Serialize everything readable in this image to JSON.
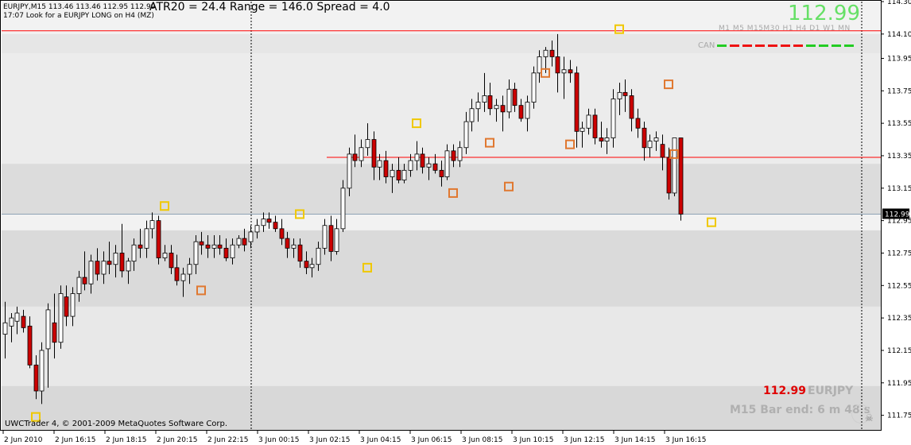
{
  "chart": {
    "symbol_info": "EURJPY,M15  113.46 113.46 112.95 112.99",
    "comment": "17:07 Look for a EURJPY LONG on H4 (MZ)",
    "stats": "ATR20 = 24.4 Range = 146.0 Spread = 4.0",
    "big_price": "112.99",
    "timeframes": "M1 M5 M15M30  H1  H4  D1  W1 MN",
    "can_label": "CAN",
    "footer_price": "112.99",
    "footer_symbol": "EURJPY",
    "bar_end": "M15 Bar end: 6 m 48 s",
    "copyright": "UWCTrader 4, © 2001-2009 MetaQuotes Software Corp.",
    "current_price_label": "112.99"
  },
  "colors": {
    "bull": "#ffffff",
    "bear": "#cc0000",
    "grid": "#000000",
    "resistance": "#ff0000",
    "price_line": "#8fa3b5",
    "marker_high": "#f0c800",
    "marker_low": "#e07830",
    "big_price": "#66e066"
  },
  "chart_data": {
    "type": "candlestick",
    "y_range": [
      111.66,
      114.3
    ],
    "y_ticks": [
      "114.30",
      "114.10",
      "113.95",
      "113.75",
      "113.55",
      "113.35",
      "113.15",
      "112.95",
      "112.75",
      "112.55",
      "112.35",
      "112.15",
      "111.95",
      "111.75"
    ],
    "x_labels": [
      "2 Jun 2010",
      "2 Jun 16:15",
      "2 Jun 18:15",
      "2 Jun 20:15",
      "2 Jun 22:15",
      "3 Jun 00:15",
      "3 Jun 02:15",
      "3 Jun 04:15",
      "3 Jun 06:15",
      "3 Jun 08:15",
      "3 Jun 10:15",
      "3 Jun 12:15",
      "3 Jun 14:15",
      "3 Jun 16:15"
    ],
    "horizontal_lines": [
      114.12,
      113.34
    ],
    "current_price": 112.99,
    "zones": [
      {
        "from": 113.98,
        "to": 114.1,
        "shade": "#e6e6e6"
      },
      {
        "from": 113.3,
        "to": 113.98,
        "shade": "#ececec"
      },
      {
        "from": 112.99,
        "to": 113.3,
        "shade": "#dcdcdc"
      },
      {
        "from": 112.42,
        "to": 112.89,
        "shade": "#dadada"
      },
      {
        "from": 111.93,
        "to": 112.42,
        "shade": "#e8e8e8"
      },
      {
        "from": 111.66,
        "to": 111.93,
        "shade": "#d8d8d8"
      }
    ],
    "candles": [
      {
        "o": 112.25,
        "h": 112.45,
        "l": 112.1,
        "c": 112.32
      },
      {
        "o": 112.3,
        "h": 112.38,
        "l": 112.2,
        "c": 112.35
      },
      {
        "o": 112.33,
        "h": 112.42,
        "l": 112.25,
        "c": 112.38
      },
      {
        "o": 112.36,
        "h": 112.4,
        "l": 112.26,
        "c": 112.29
      },
      {
        "o": 112.3,
        "h": 112.36,
        "l": 112.04,
        "c": 112.06
      },
      {
        "o": 112.06,
        "h": 112.12,
        "l": 111.85,
        "c": 111.9
      },
      {
        "o": 111.9,
        "h": 112.2,
        "l": 111.82,
        "c": 112.15
      },
      {
        "o": 112.16,
        "h": 112.44,
        "l": 111.92,
        "c": 112.4
      },
      {
        "o": 112.32,
        "h": 112.5,
        "l": 112.1,
        "c": 112.2
      },
      {
        "o": 112.2,
        "h": 112.55,
        "l": 112.16,
        "c": 112.5
      },
      {
        "o": 112.48,
        "h": 112.55,
        "l": 112.3,
        "c": 112.36
      },
      {
        "o": 112.36,
        "h": 112.54,
        "l": 112.3,
        "c": 112.5
      },
      {
        "o": 112.5,
        "h": 112.64,
        "l": 112.45,
        "c": 112.6
      },
      {
        "o": 112.6,
        "h": 112.76,
        "l": 112.52,
        "c": 112.56
      },
      {
        "o": 112.56,
        "h": 112.74,
        "l": 112.5,
        "c": 112.7
      },
      {
        "o": 112.7,
        "h": 112.78,
        "l": 112.58,
        "c": 112.62
      },
      {
        "o": 112.62,
        "h": 112.76,
        "l": 112.56,
        "c": 112.7
      },
      {
        "o": 112.7,
        "h": 112.82,
        "l": 112.62,
        "c": 112.68
      },
      {
        "o": 112.68,
        "h": 112.8,
        "l": 112.6,
        "c": 112.75
      },
      {
        "o": 112.75,
        "h": 112.93,
        "l": 112.6,
        "c": 112.64
      },
      {
        "o": 112.64,
        "h": 112.72,
        "l": 112.56,
        "c": 112.7
      },
      {
        "o": 112.7,
        "h": 112.84,
        "l": 112.64,
        "c": 112.8
      },
      {
        "o": 112.8,
        "h": 112.9,
        "l": 112.72,
        "c": 112.78
      },
      {
        "o": 112.78,
        "h": 112.95,
        "l": 112.72,
        "c": 112.9
      },
      {
        "o": 112.9,
        "h": 113.0,
        "l": 112.84,
        "c": 112.95
      },
      {
        "o": 112.95,
        "h": 112.98,
        "l": 112.68,
        "c": 112.72
      },
      {
        "o": 112.72,
        "h": 112.8,
        "l": 112.7,
        "c": 112.75
      },
      {
        "o": 112.75,
        "h": 112.8,
        "l": 112.62,
        "c": 112.66
      },
      {
        "o": 112.66,
        "h": 112.74,
        "l": 112.55,
        "c": 112.58
      },
      {
        "o": 112.58,
        "h": 112.66,
        "l": 112.48,
        "c": 112.62
      },
      {
        "o": 112.62,
        "h": 112.72,
        "l": 112.56,
        "c": 112.68
      },
      {
        "o": 112.68,
        "h": 112.86,
        "l": 112.62,
        "c": 112.82
      },
      {
        "o": 112.82,
        "h": 112.88,
        "l": 112.74,
        "c": 112.8
      },
      {
        "o": 112.8,
        "h": 112.86,
        "l": 112.72,
        "c": 112.78
      },
      {
        "o": 112.78,
        "h": 112.86,
        "l": 112.72,
        "c": 112.8
      },
      {
        "o": 112.8,
        "h": 112.86,
        "l": 112.74,
        "c": 112.78
      },
      {
        "o": 112.78,
        "h": 112.84,
        "l": 112.7,
        "c": 112.72
      },
      {
        "o": 112.72,
        "h": 112.84,
        "l": 112.68,
        "c": 112.8
      },
      {
        "o": 112.8,
        "h": 112.86,
        "l": 112.78,
        "c": 112.84
      },
      {
        "o": 112.84,
        "h": 112.9,
        "l": 112.76,
        "c": 112.8
      },
      {
        "o": 112.82,
        "h": 112.92,
        "l": 112.78,
        "c": 112.88
      },
      {
        "o": 112.88,
        "h": 112.96,
        "l": 112.84,
        "c": 112.92
      },
      {
        "o": 112.92,
        "h": 113.0,
        "l": 112.88,
        "c": 112.96
      },
      {
        "o": 112.96,
        "h": 113.0,
        "l": 112.9,
        "c": 112.94
      },
      {
        "o": 112.94,
        "h": 112.98,
        "l": 112.88,
        "c": 112.9
      },
      {
        "o": 112.9,
        "h": 112.96,
        "l": 112.8,
        "c": 112.84
      },
      {
        "o": 112.84,
        "h": 112.88,
        "l": 112.72,
        "c": 112.78
      },
      {
        "o": 112.78,
        "h": 112.84,
        "l": 112.72,
        "c": 112.8
      },
      {
        "o": 112.8,
        "h": 112.84,
        "l": 112.66,
        "c": 112.7
      },
      {
        "o": 112.7,
        "h": 112.76,
        "l": 112.62,
        "c": 112.66
      },
      {
        "o": 112.66,
        "h": 112.72,
        "l": 112.6,
        "c": 112.68
      },
      {
        "o": 112.68,
        "h": 112.82,
        "l": 112.64,
        "c": 112.78
      },
      {
        "o": 112.78,
        "h": 112.96,
        "l": 112.74,
        "c": 112.92
      },
      {
        "o": 112.92,
        "h": 112.98,
        "l": 112.7,
        "c": 112.76
      },
      {
        "o": 112.76,
        "h": 112.96,
        "l": 112.74,
        "c": 112.9
      },
      {
        "o": 112.9,
        "h": 113.2,
        "l": 112.88,
        "c": 113.15
      },
      {
        "o": 113.15,
        "h": 113.4,
        "l": 113.1,
        "c": 113.36
      },
      {
        "o": 113.36,
        "h": 113.48,
        "l": 113.28,
        "c": 113.32
      },
      {
        "o": 113.32,
        "h": 113.45,
        "l": 113.28,
        "c": 113.4
      },
      {
        "o": 113.4,
        "h": 113.55,
        "l": 113.35,
        "c": 113.45
      },
      {
        "o": 113.45,
        "h": 113.5,
        "l": 113.2,
        "c": 113.28
      },
      {
        "o": 113.28,
        "h": 113.36,
        "l": 113.2,
        "c": 113.32
      },
      {
        "o": 113.32,
        "h": 113.38,
        "l": 113.18,
        "c": 113.22
      },
      {
        "o": 113.22,
        "h": 113.3,
        "l": 113.12,
        "c": 113.26
      },
      {
        "o": 113.26,
        "h": 113.34,
        "l": 113.18,
        "c": 113.2
      },
      {
        "o": 113.2,
        "h": 113.3,
        "l": 113.18,
        "c": 113.26
      },
      {
        "o": 113.26,
        "h": 113.36,
        "l": 113.22,
        "c": 113.32
      },
      {
        "o": 113.32,
        "h": 113.44,
        "l": 113.26,
        "c": 113.36
      },
      {
        "o": 113.36,
        "h": 113.4,
        "l": 113.24,
        "c": 113.28
      },
      {
        "o": 113.28,
        "h": 113.34,
        "l": 113.2,
        "c": 113.3
      },
      {
        "o": 113.3,
        "h": 113.36,
        "l": 113.24,
        "c": 113.26
      },
      {
        "o": 113.26,
        "h": 113.32,
        "l": 113.16,
        "c": 113.22
      },
      {
        "o": 113.22,
        "h": 113.42,
        "l": 113.2,
        "c": 113.38
      },
      {
        "o": 113.38,
        "h": 113.42,
        "l": 113.28,
        "c": 113.32
      },
      {
        "o": 113.32,
        "h": 113.44,
        "l": 113.28,
        "c": 113.4
      },
      {
        "o": 113.4,
        "h": 113.62,
        "l": 113.36,
        "c": 113.56
      },
      {
        "o": 113.56,
        "h": 113.7,
        "l": 113.5,
        "c": 113.64
      },
      {
        "o": 113.64,
        "h": 113.74,
        "l": 113.56,
        "c": 113.68
      },
      {
        "o": 113.68,
        "h": 113.86,
        "l": 113.62,
        "c": 113.72
      },
      {
        "o": 113.72,
        "h": 113.8,
        "l": 113.6,
        "c": 113.64
      },
      {
        "o": 113.64,
        "h": 113.7,
        "l": 113.56,
        "c": 113.66
      },
      {
        "o": 113.66,
        "h": 113.72,
        "l": 113.5,
        "c": 113.62
      },
      {
        "o": 113.62,
        "h": 113.82,
        "l": 113.58,
        "c": 113.76
      },
      {
        "o": 113.76,
        "h": 113.8,
        "l": 113.62,
        "c": 113.66
      },
      {
        "o": 113.66,
        "h": 113.7,
        "l": 113.56,
        "c": 113.58
      },
      {
        "o": 113.58,
        "h": 113.72,
        "l": 113.5,
        "c": 113.68
      },
      {
        "o": 113.68,
        "h": 113.9,
        "l": 113.64,
        "c": 113.86
      },
      {
        "o": 113.86,
        "h": 114.0,
        "l": 113.8,
        "c": 113.96
      },
      {
        "o": 113.96,
        "h": 114.02,
        "l": 113.86,
        "c": 114.0
      },
      {
        "o": 114.0,
        "h": 114.06,
        "l": 113.9,
        "c": 113.96
      },
      {
        "o": 113.96,
        "h": 114.1,
        "l": 113.74,
        "c": 113.86
      },
      {
        "o": 113.86,
        "h": 113.96,
        "l": 113.7,
        "c": 113.88
      },
      {
        "o": 113.88,
        "h": 113.94,
        "l": 113.8,
        "c": 113.86
      },
      {
        "o": 113.86,
        "h": 113.9,
        "l": 113.4,
        "c": 113.5
      },
      {
        "o": 113.5,
        "h": 113.56,
        "l": 113.4,
        "c": 113.52
      },
      {
        "o": 113.52,
        "h": 113.64,
        "l": 113.48,
        "c": 113.6
      },
      {
        "o": 113.6,
        "h": 113.64,
        "l": 113.42,
        "c": 113.46
      },
      {
        "o": 113.46,
        "h": 113.56,
        "l": 113.4,
        "c": 113.44
      },
      {
        "o": 113.44,
        "h": 113.52,
        "l": 113.36,
        "c": 113.46
      },
      {
        "o": 113.46,
        "h": 113.76,
        "l": 113.4,
        "c": 113.7
      },
      {
        "o": 113.7,
        "h": 113.8,
        "l": 113.6,
        "c": 113.74
      },
      {
        "o": 113.74,
        "h": 113.82,
        "l": 113.62,
        "c": 113.72
      },
      {
        "o": 113.72,
        "h": 113.76,
        "l": 113.5,
        "c": 113.58
      },
      {
        "o": 113.58,
        "h": 113.64,
        "l": 113.46,
        "c": 113.52
      },
      {
        "o": 113.52,
        "h": 113.56,
        "l": 113.32,
        "c": 113.4
      },
      {
        "o": 113.4,
        "h": 113.48,
        "l": 113.34,
        "c": 113.44
      },
      {
        "o": 113.44,
        "h": 113.5,
        "l": 113.38,
        "c": 113.46
      },
      {
        "o": 113.42,
        "h": 113.48,
        "l": 113.26,
        "c": 113.34
      },
      {
        "o": 113.34,
        "h": 113.4,
        "l": 113.08,
        "c": 113.12
      },
      {
        "o": 113.12,
        "h": 113.46,
        "l": 113.1,
        "c": 113.46
      },
      {
        "o": 113.46,
        "h": 113.46,
        "l": 112.95,
        "c": 112.99
      }
    ],
    "markers": [
      {
        "i": 5,
        "v": 111.74,
        "kind": "high"
      },
      {
        "i": 26,
        "v": 113.04,
        "kind": "high"
      },
      {
        "i": 32,
        "v": 112.52,
        "kind": "low"
      },
      {
        "i": 48,
        "v": 112.99,
        "kind": "high"
      },
      {
        "i": 59,
        "v": 112.66,
        "kind": "high"
      },
      {
        "i": 67,
        "v": 113.55,
        "kind": "high"
      },
      {
        "i": 73,
        "v": 113.12,
        "kind": "low"
      },
      {
        "i": 79,
        "v": 113.43,
        "kind": "low"
      },
      {
        "i": 82,
        "v": 113.16,
        "kind": "low"
      },
      {
        "i": 88,
        "v": 113.86,
        "kind": "low"
      },
      {
        "i": 92,
        "v": 113.42,
        "kind": "low"
      },
      {
        "i": 100,
        "v": 114.13,
        "kind": "high"
      },
      {
        "i": 108,
        "v": 113.79,
        "kind": "low"
      },
      {
        "i": 109,
        "v": 113.36,
        "kind": "low"
      },
      {
        "i": 115,
        "v": 112.94,
        "kind": "high"
      }
    ]
  }
}
